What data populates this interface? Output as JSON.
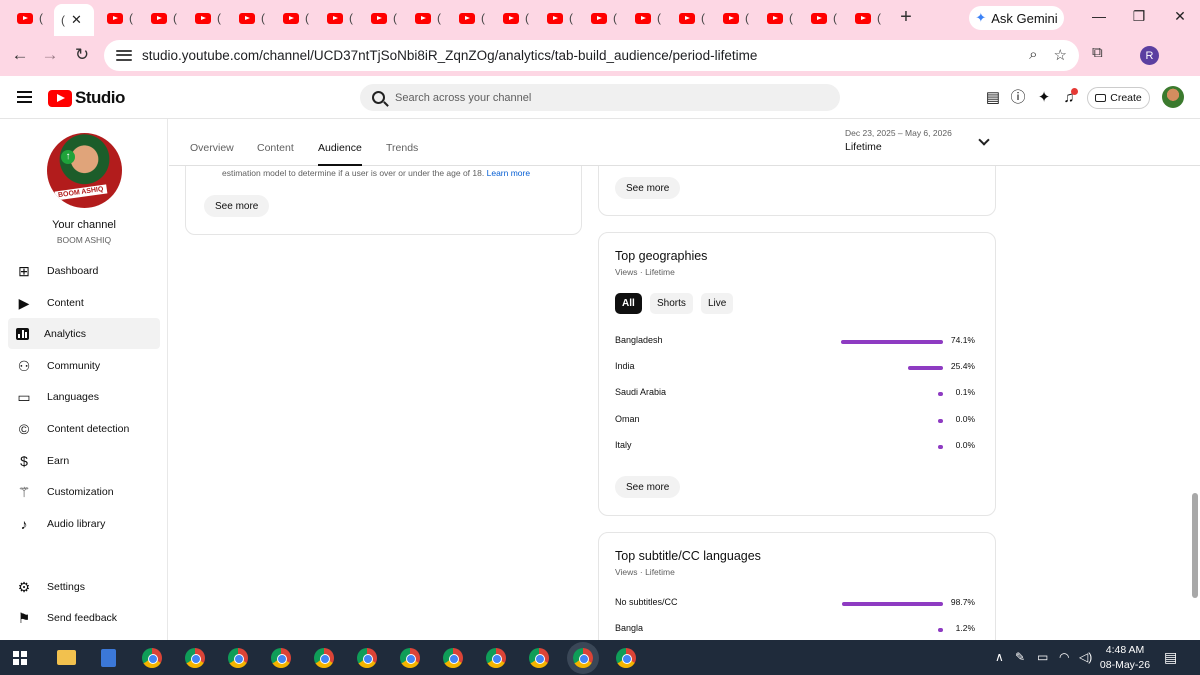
{
  "browser": {
    "tab_paren": "(",
    "tab_close": "✕",
    "new_tab": "+",
    "ask_gemini": "Ask Gemini",
    "url": "studio.youtube.com/channel/UCD37ntTjSoNbi8iR_ZqnZOg/analytics/tab-build_audience/period-lifetime",
    "profile_initial": "R"
  },
  "header": {
    "logo_text": "Studio",
    "search_placeholder": "Search across your channel",
    "create_label": "Create"
  },
  "sidebar": {
    "your_channel": "Your channel",
    "channel_name": "BOOM ASHIQ",
    "avatar_badge": "BOOM ASHIQ",
    "items": [
      {
        "label": "Dashboard",
        "icon": "dashboard-icon"
      },
      {
        "label": "Content",
        "icon": "content-icon"
      },
      {
        "label": "Analytics",
        "icon": "analytics-icon",
        "active": true
      },
      {
        "label": "Community",
        "icon": "community-icon"
      },
      {
        "label": "Languages",
        "icon": "languages-icon"
      },
      {
        "label": "Content detection",
        "icon": "copyright-icon"
      },
      {
        "label": "Earn",
        "icon": "dollar-icon"
      },
      {
        "label": "Customization",
        "icon": "wand-icon"
      },
      {
        "label": "Audio library",
        "icon": "audio-library-icon"
      }
    ],
    "bottom": [
      {
        "label": "Settings",
        "icon": "gear-icon"
      },
      {
        "label": "Send feedback",
        "icon": "feedback-icon"
      }
    ]
  },
  "analytics": {
    "tabs": [
      "Overview",
      "Content",
      "Audience",
      "Trends"
    ],
    "active_tab": "Audience",
    "date_range": "Dec 23, 2025 – May 6, 2026",
    "period": "Lifetime"
  },
  "left_card": {
    "note_text": "estimation model to determine if a user is over or under the age of 18.",
    "learn_more": "Learn more",
    "see_more": "See more"
  },
  "right_top_card": {
    "see_more": "See more"
  },
  "geographies": {
    "title": "Top geographies",
    "subtitle": "Views · Lifetime",
    "chips": [
      "All",
      "Shorts",
      "Live"
    ],
    "active_chip": "All",
    "rows": [
      {
        "label": "Bangladesh",
        "value": "74.1%",
        "pct": 74.1
      },
      {
        "label": "India",
        "value": "25.4%",
        "pct": 25.4
      },
      {
        "label": "Saudi Arabia",
        "value": "0.1%",
        "pct": 0.1
      },
      {
        "label": "Oman",
        "value": "0.0%",
        "pct": 0.0
      },
      {
        "label": "Italy",
        "value": "0.0%",
        "pct": 0.0
      }
    ],
    "see_more": "See more"
  },
  "subtitles": {
    "title": "Top subtitle/CC languages",
    "subtitle": "Views · Lifetime",
    "rows": [
      {
        "label": "No subtitles/CC",
        "value": "98.7%",
        "pct": 98.7
      },
      {
        "label": "Bangla",
        "value": "1.2%",
        "pct": 1.2
      }
    ]
  },
  "taskbar": {
    "time": "4:48 AM",
    "date": "08-May-26"
  }
}
